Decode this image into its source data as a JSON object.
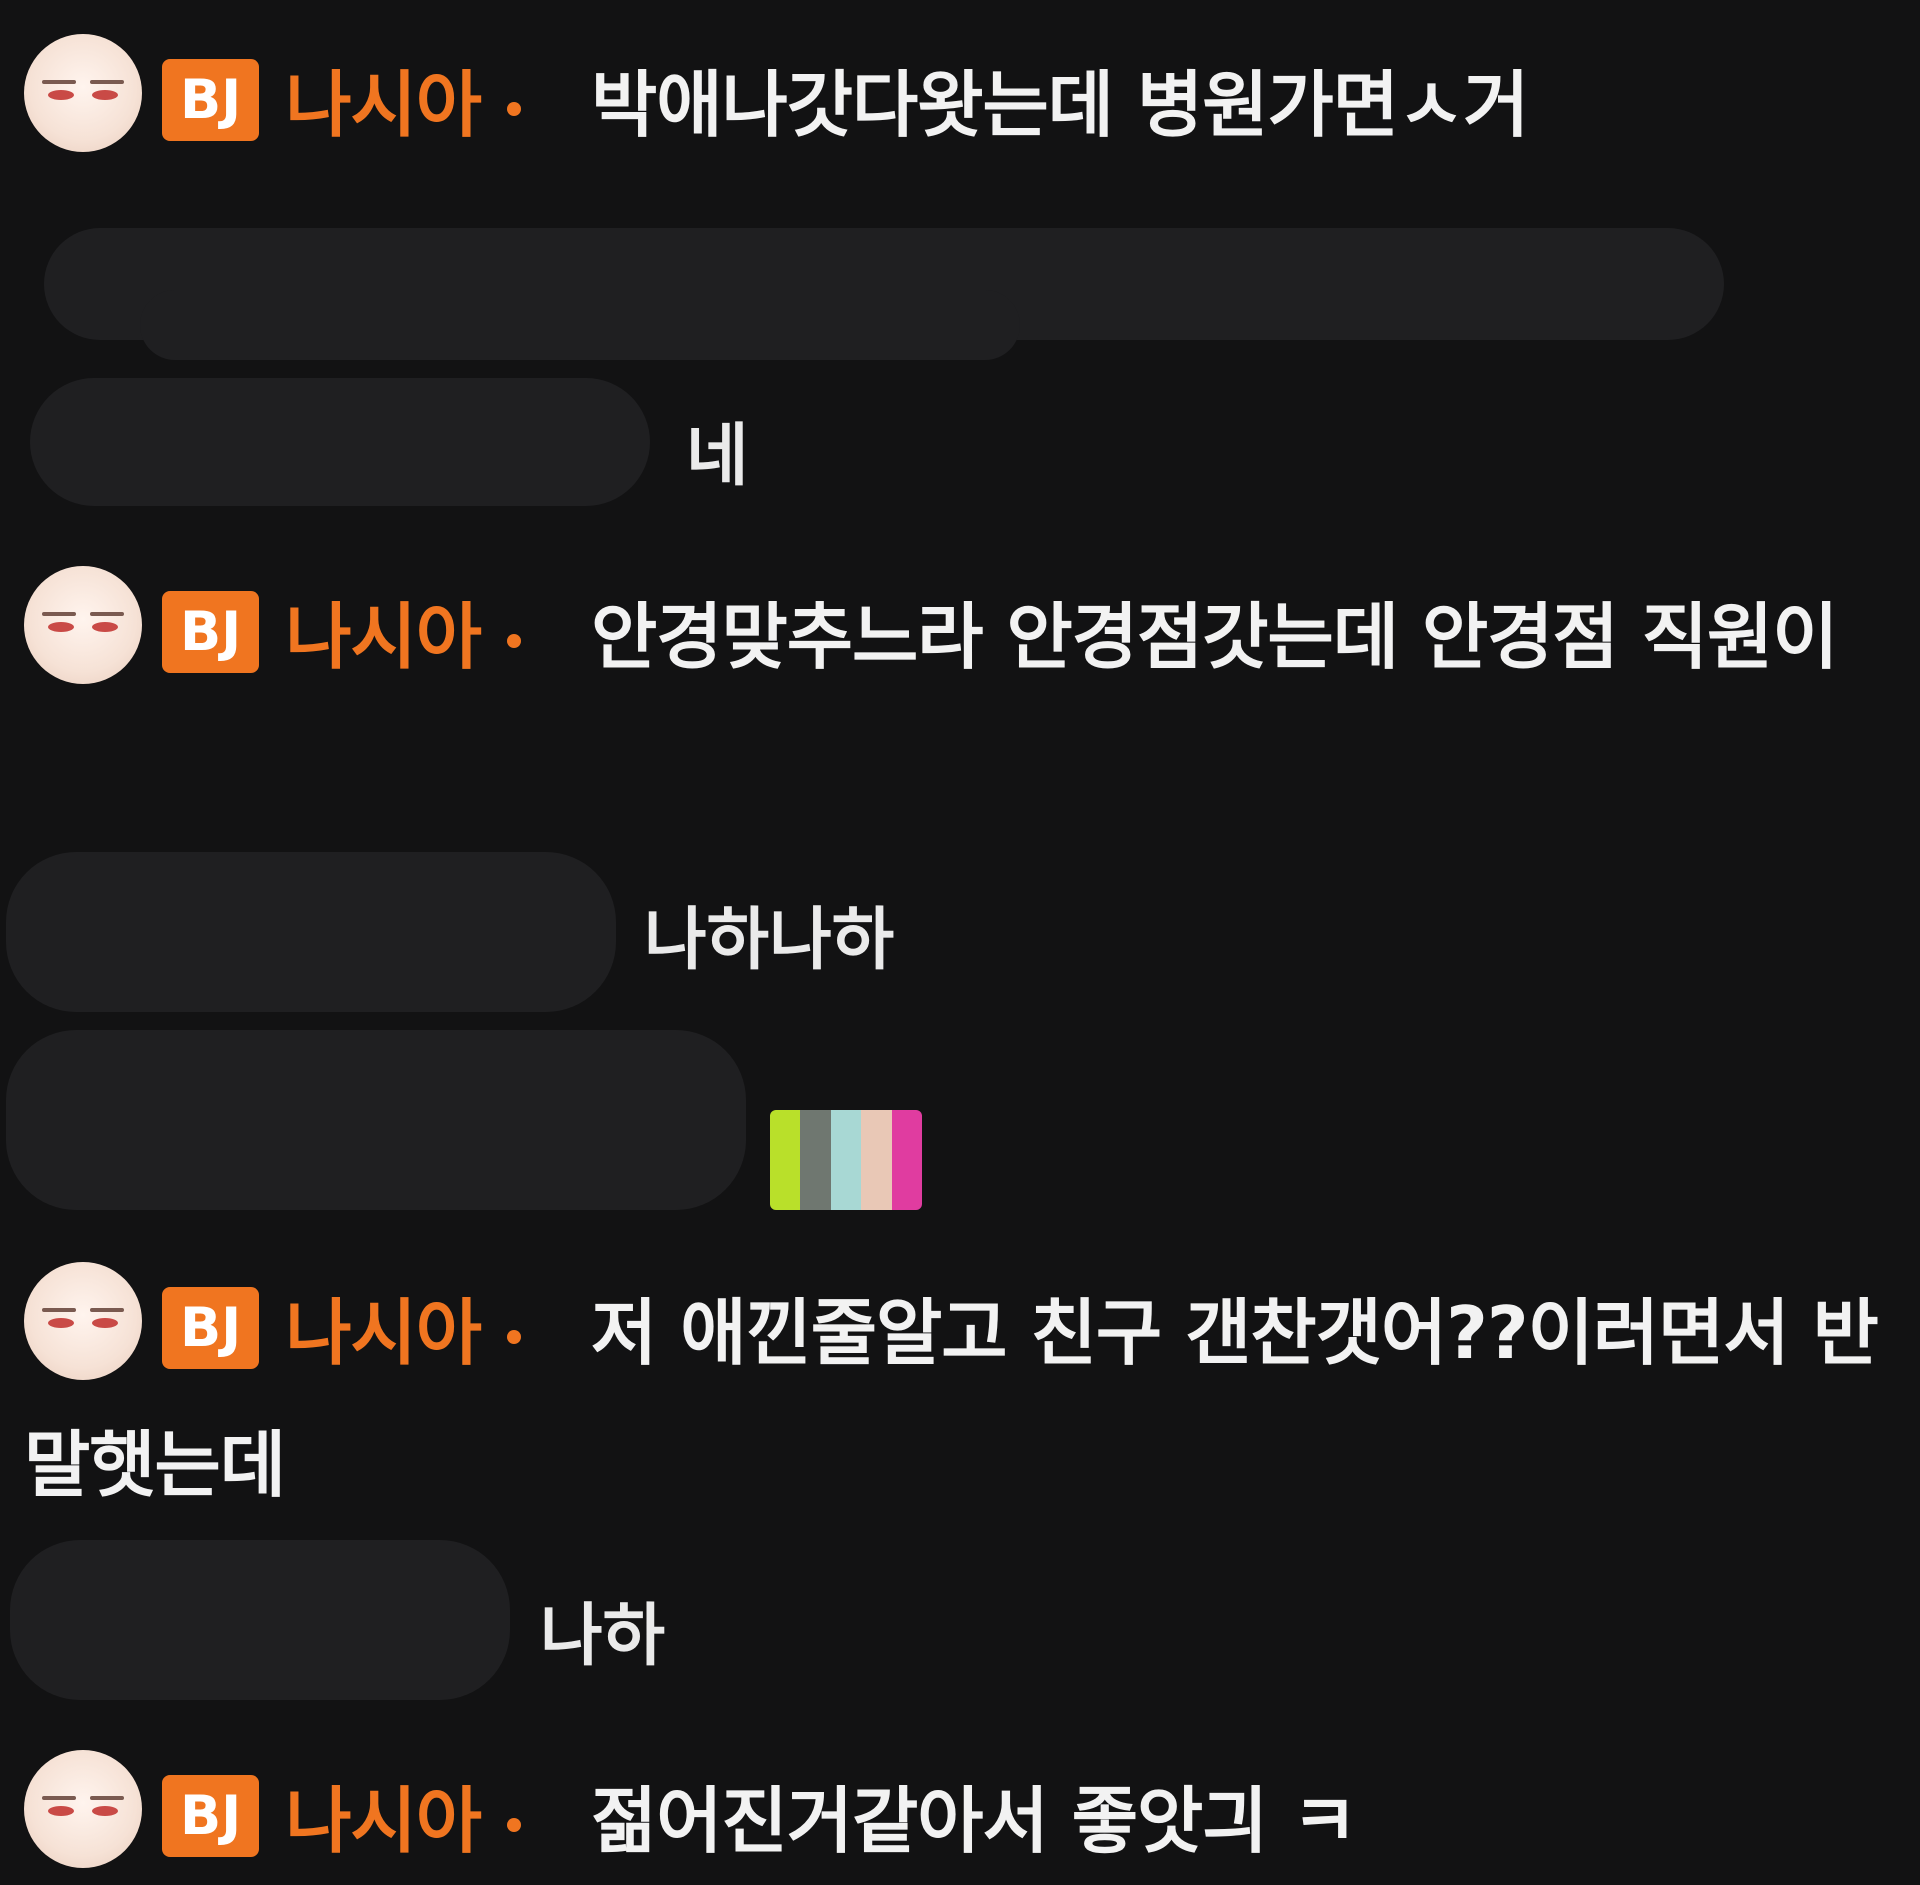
{
  "bj": {
    "badge": "BJ",
    "nickname": "나시아"
  },
  "messages": [
    {
      "type": "bj",
      "text": "박애나갓다왓는데 병원가면ㅅ거"
    },
    {
      "type": "viewer",
      "text": ""
    },
    {
      "type": "viewer",
      "text": "네"
    },
    {
      "type": "bj",
      "text": "안경맞추느라 안경점갓는데 안경점 직원이"
    },
    {
      "type": "viewer",
      "text": "나하나하"
    },
    {
      "type": "viewer",
      "emote": "emote-sticker"
    },
    {
      "type": "bj",
      "text": "저 애낀줄알고 친구 갠찬갯어??이러면서 반말햇는데"
    },
    {
      "type": "viewer",
      "text": "나하"
    },
    {
      "type": "bj",
      "text": "젊어진거같아서 좋앗긔 ㅋ"
    }
  ],
  "colors": {
    "background": "#121213",
    "accent": "#f07520",
    "text": "#f2f2f2"
  }
}
